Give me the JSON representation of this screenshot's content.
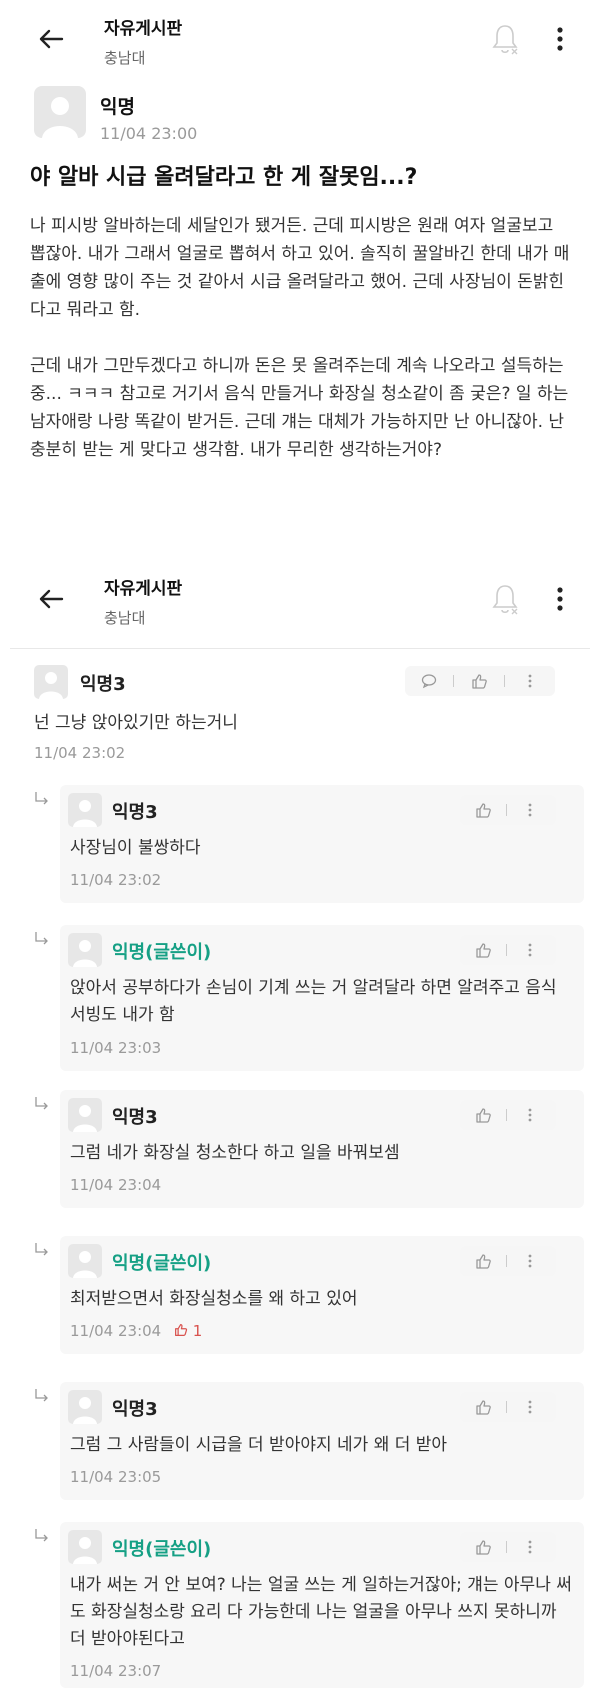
{
  "header": {
    "title": "자유게시판",
    "subtitle": "충남대"
  },
  "post": {
    "author": "익명",
    "time": "11/04 23:00",
    "title": "야 알바 시급 올려달라고 한 게 잘못임...?",
    "paragraphs": [
      "나 피시방 알바하는데 세달인가 됐거든. 근데 피시방은 원래 여자 얼굴보고 뽑잖아. 내가 그래서 얼굴로 뽑혀서 하고 있어. 솔직히 꿀알바긴 한데 내가 매출에 영향 많이 주는 것 같아서 시급 올려달라고 했어. 근데 사장님이 돈밝힌다고 뭐라고 함.",
      "근데 내가 그만두겠다고 하니까 돈은 못 올려주는데 계속 나오라고 설득하는 중... ㅋㅋㅋ 참고로 거기서 음식 만들거나 화장실 청소같이 좀 궂은? 일 하는 남자애랑 나랑 똑같이 받거든. 근데 걔는 대체가 가능하지만 난 아니잖아. 난 충분히 받는 게 맞다고 생각함. 내가 무리한 생각하는거야?"
    ]
  },
  "header2": {
    "title": "자유게시판",
    "subtitle": "충남대"
  },
  "comments": [
    {
      "name": "익명3",
      "text": "넌 그냥 앉아있기만 하는거니",
      "time": "11/04 23:02"
    },
    {
      "name": "익명3",
      "text": "사장님이 불쌍하다",
      "time": "11/04 23:02"
    },
    {
      "name": "익명(글쓴이)",
      "text": "앉아서 공부하다가 손님이 기계 쓰는 거 알려달라 하면 알려주고 음식 서빙도 내가 함",
      "time": "11/04 23:03"
    },
    {
      "name": "익명3",
      "text": "그럼 네가 화장실 청소한다 하고 일을 바꿔보셈",
      "time": "11/04 23:04"
    },
    {
      "name": "익명(글쓴이)",
      "text": "최저받으면서 화장실청소를 왜 하고 있어",
      "time": "11/04 23:04",
      "likes": "1"
    },
    {
      "name": "익명3",
      "text": "그럼 그 사람들이 시급을 더 받아야지 네가 왜 더 받아",
      "time": "11/04 23:05"
    },
    {
      "name": "익명(글쓴이)",
      "text": "내가 써논 거 안 보여? 나는 얼굴 쓰는 게 일하는거잖아; 걔는 아무나 써도 화장실청소랑 요리 다 가능한데 나는 얼굴을 아무나 쓰지 못하니까 더 받아야된다고",
      "time": "11/04 23:07"
    }
  ],
  "icons": {
    "back": "back-arrow-icon",
    "bell": "bell-off-icon",
    "more": "more-vertical-icon",
    "comment": "comment-icon",
    "like": "thumbs-up-icon",
    "reply": "reply-arrow-icon"
  },
  "colors": {
    "op_name": "#16a085",
    "like_count": "#d9534f",
    "timestamp": "#9a9a9a"
  }
}
